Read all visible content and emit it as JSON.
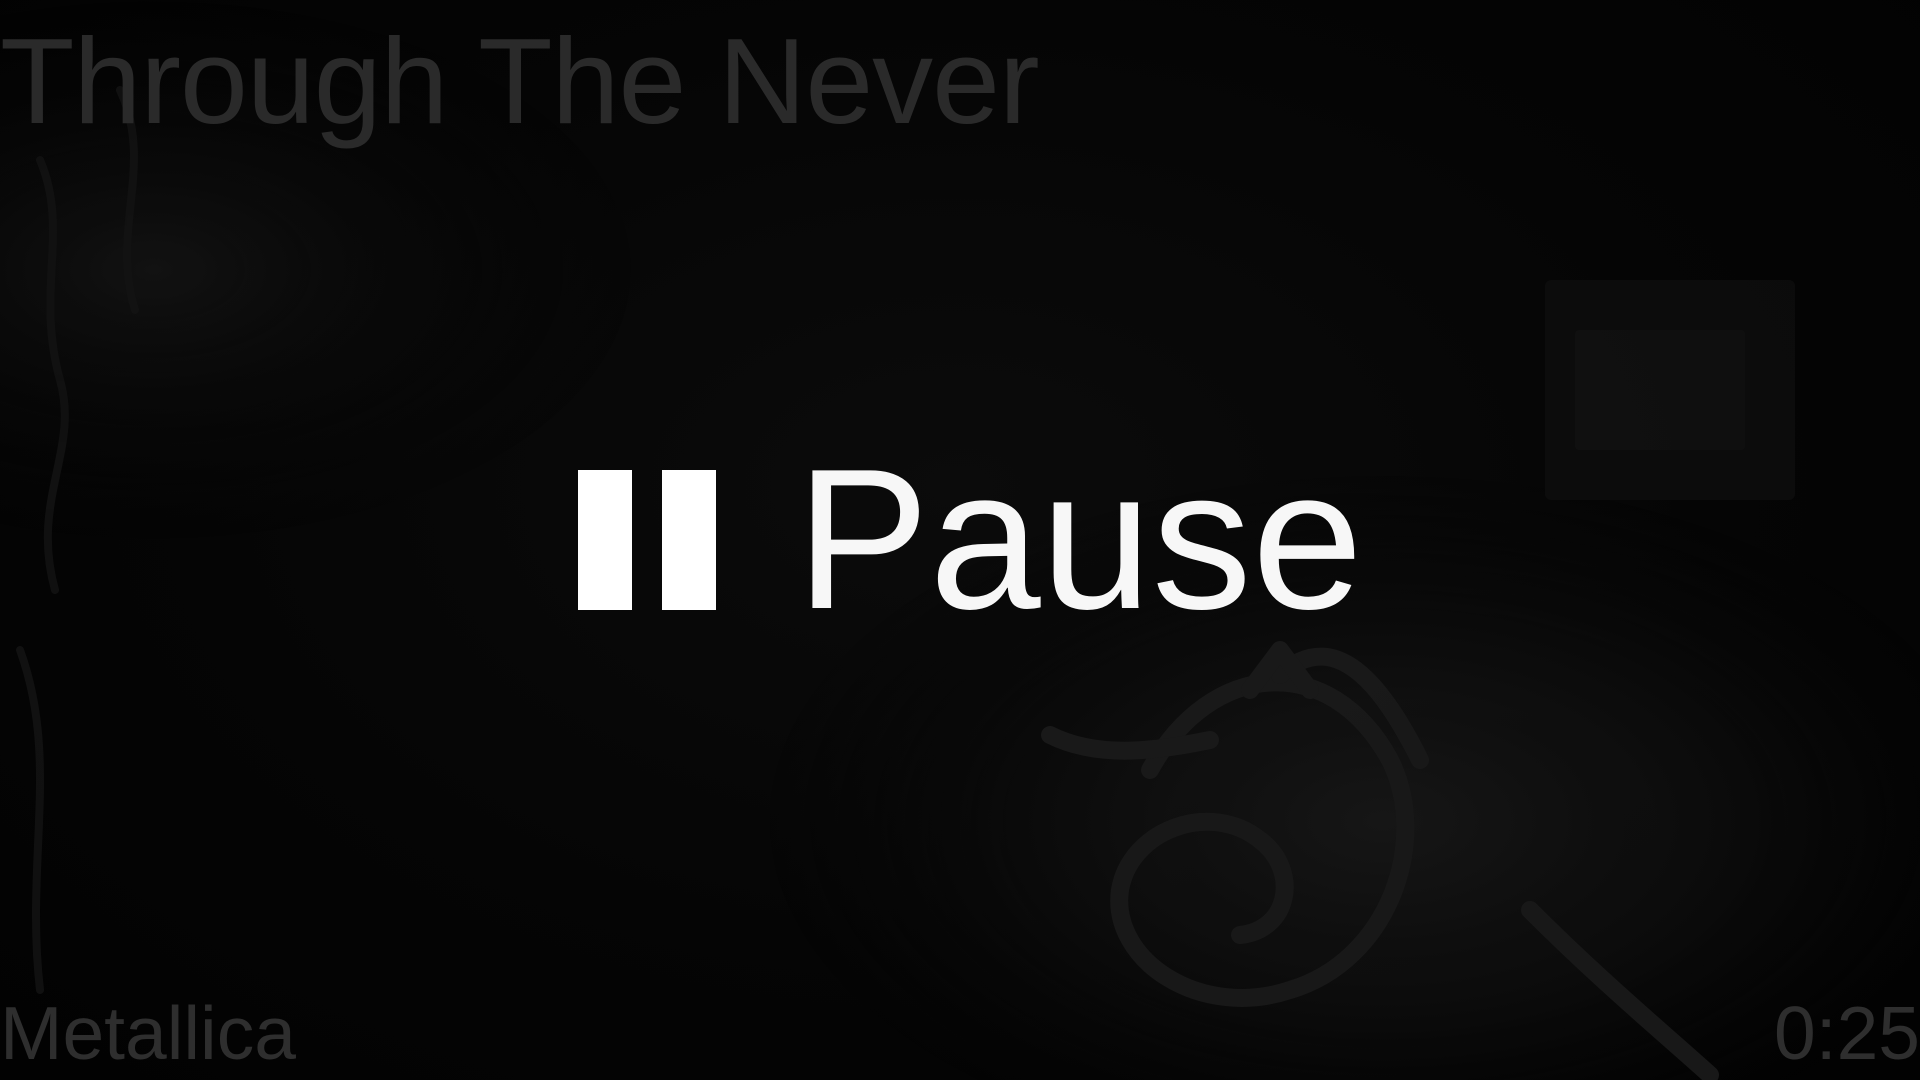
{
  "track": {
    "title": "Through The Never",
    "artist": "Metallica",
    "elapsed": "0:25"
  },
  "action": {
    "label": "Pause",
    "icon": "pause-icon"
  },
  "colors": {
    "background": "#050505",
    "primary_text": "#f7f7f7",
    "muted_text": "#2a2a2a"
  }
}
